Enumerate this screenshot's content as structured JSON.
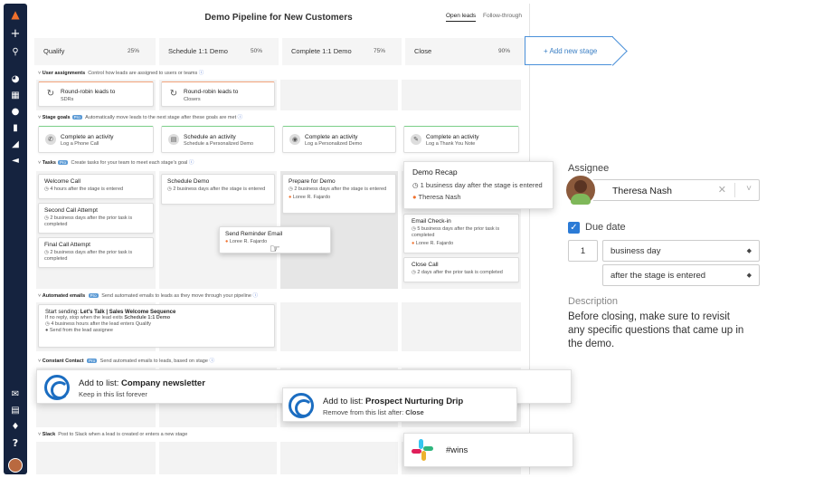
{
  "nav": {
    "icons": [
      "logo-icon",
      "plus-icon",
      "search-icon",
      "dashboard-icon",
      "org-icon",
      "person-icon",
      "deals-icon",
      "reports-icon",
      "megaphone-icon",
      "mail-icon",
      "calendar-icon",
      "notification-icon",
      "help-icon"
    ],
    "glyphs": {
      "plus": "+",
      "help": "?"
    }
  },
  "header": {
    "title": "Demo Pipeline for New Customers",
    "tabs": [
      "Open leads",
      "Follow-through"
    ]
  },
  "stages": [
    {
      "name": "Qualify",
      "pct": "25%"
    },
    {
      "name": "Schedule 1:1 Demo",
      "pct": "50%"
    },
    {
      "name": "Complete 1:1 Demo",
      "pct": "75%"
    },
    {
      "name": "Close",
      "pct": "90%"
    }
  ],
  "add_stage": "+ Add new stage",
  "sections": {
    "user_assignments": {
      "title": "User assignments",
      "desc": "Control how leads are assigned to users or teams"
    },
    "stage_goals": {
      "title": "Stage goals",
      "badge": "Pro",
      "desc": "Automatically move leads to the next stage after these goals are met"
    },
    "tasks": {
      "title": "Tasks",
      "badge": "Pro",
      "desc": "Create tasks for your team to meet each stage's goal"
    },
    "automated_emails": {
      "title": "Automated emails",
      "badge": "Pro",
      "desc": "Send automated emails to leads as they move through your pipeline"
    },
    "constant_contact": {
      "title": "Constant Contact",
      "badge": "Pro",
      "desc": "Send automated emails to leads, based on stage"
    },
    "slack": {
      "title": "Slack",
      "desc": "Post to Slack when a lead is created or enters a new stage"
    }
  },
  "assign_cards": [
    {
      "title": "Round-robin leads to",
      "sub": "SDRs"
    },
    {
      "title": "Round-robin leads to",
      "sub": "Closers"
    }
  ],
  "goal_cards": [
    {
      "title": "Complete an activity",
      "sub": "Log a Phone Call"
    },
    {
      "title": "Schedule an activity",
      "sub": "Schedule a Personalized Demo"
    },
    {
      "title": "Complete an activity",
      "sub": "Log a Personalized Demo"
    },
    {
      "title": "Complete an activity",
      "sub": "Log a Thank You Note"
    }
  ],
  "tasks": {
    "welcome": {
      "title": "Welcome Call",
      "sub": "4 hours after the stage is entered"
    },
    "second": {
      "title": "Second Call Attempt",
      "sub": "2 business days after the prior task is completed"
    },
    "final": {
      "title": "Final Call Attempt",
      "sub": "2 business days after the prior task is completed"
    },
    "schedule": {
      "title": "Schedule Demo",
      "sub": "2 business days after the stage is entered"
    },
    "reminder": {
      "title": "Send Reminder Email",
      "person": "Loree R. Fajardo"
    },
    "prepare": {
      "title": "Prepare for Demo",
      "sub": "2 business days after the stage is entered",
      "person": "Loree R. Fajardo"
    },
    "recap": {
      "title": "Demo Recap",
      "sub": "1 business day after the stage is entered",
      "person": "Theresa Nash"
    },
    "checkin": {
      "title": "Email Check-in",
      "sub": "5 business days after the prior task is completed",
      "person": "Loree R. Fajardo"
    },
    "close": {
      "title": "Close Call",
      "sub": "2 days after the prior task is completed"
    }
  },
  "email_card": {
    "prefix": "Start sending: ",
    "name": "Let's Talk | Sales Welcome Sequence",
    "stop_prefix": "If no reply, stop when the lead exits ",
    "stop_stage": "Schedule 1:1 Demo",
    "timing": "4 business hours after the lead enters Qualify",
    "from": "Send from the lead assignee"
  },
  "cc_cards": [
    {
      "prefix": "Add to list: ",
      "list": "Company newsletter",
      "sub": "Keep in this list forever"
    },
    {
      "prefix": "Add to list: ",
      "list": "Prospect Nurturing Drip",
      "sub_prefix": "Remove from this list after: ",
      "sub_value": "Close"
    }
  ],
  "slack_card": {
    "channel": "#wins"
  },
  "detail": {
    "assignee_label": "Assignee",
    "assignee": "Theresa Nash",
    "due_label": "Due date",
    "due_number": "1",
    "due_unit": "business day",
    "due_rel": "after the stage is entered",
    "desc_label": "Description",
    "desc": "Before closing, make sure to revisit any specific questions that came up in the demo."
  },
  "colors": {
    "accent": "#3b7fc4",
    "navbar": "#15233f",
    "cc_blue": "#1b6dc1",
    "checkbox": "#2b7bd6"
  }
}
